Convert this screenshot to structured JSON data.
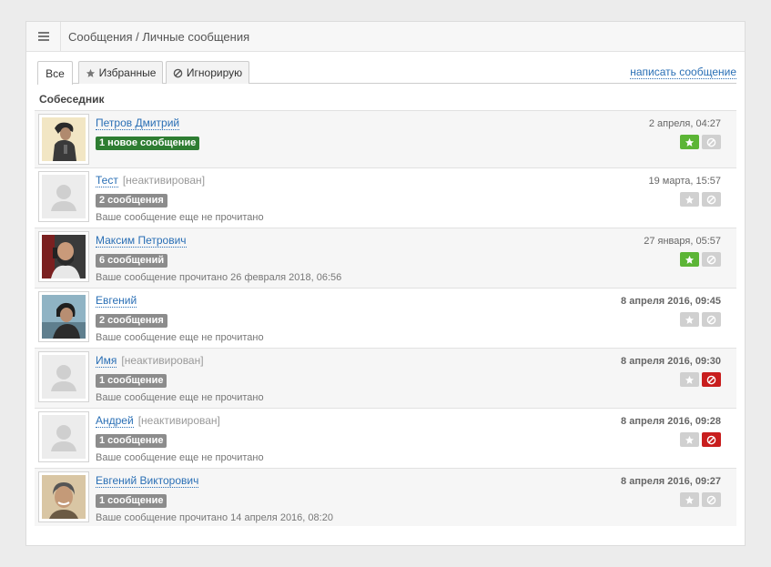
{
  "header": {
    "title": "Сообщения / Личные сообщения",
    "menu_icon": "list-icon"
  },
  "tabs": [
    {
      "label": "Все",
      "icon": "",
      "active": true
    },
    {
      "label": "Избранные",
      "icon": "star-icon",
      "active": false
    },
    {
      "label": "Игнорирую",
      "icon": "ban-icon",
      "active": false
    }
  ],
  "write_link": "написать сообщение",
  "column_header": "Собеседник",
  "colors": {
    "link": "#2a6fb5",
    "new_badge": "#2e7d32",
    "badge": "#8c8c8c",
    "favorite_on": "#5cb536",
    "ignore_on": "#c81e1e",
    "button_off": "#d0d0d0"
  },
  "conversations": [
    {
      "name": "Петров Дмитрий",
      "inactive": "",
      "count": "1 новое сообщение",
      "new": true,
      "status": "",
      "date": "2 апреля, 04:27",
      "date_bold": false,
      "favorite": true,
      "ignored": false,
      "avatar": "photo"
    },
    {
      "name": "Тест",
      "inactive": "[неактивирован]",
      "count": "2 сообщения",
      "new": false,
      "status": "Ваше сообщение еще не прочитано",
      "date": "19 марта, 15:57",
      "date_bold": false,
      "favorite": false,
      "ignored": false,
      "avatar": "placeholder"
    },
    {
      "name": "Максим Петрович",
      "inactive": "",
      "count": "6 сообщений",
      "new": false,
      "status": "Ваше сообщение прочитано 26 февраля 2018, 06:56",
      "date": "27 января, 05:57",
      "date_bold": false,
      "favorite": true,
      "ignored": false,
      "avatar": "photo"
    },
    {
      "name": "Евгений",
      "inactive": "",
      "count": "2 сообщения",
      "new": false,
      "status": "Ваше сообщение еще не прочитано",
      "date": "8 апреля 2016, 09:45",
      "date_bold": true,
      "favorite": false,
      "ignored": false,
      "avatar": "photo"
    },
    {
      "name": "Имя",
      "inactive": "[неактивирован]",
      "count": "1 сообщение",
      "new": false,
      "status": "Ваше сообщение еще не прочитано",
      "date": "8 апреля 2016, 09:30",
      "date_bold": true,
      "favorite": false,
      "ignored": true,
      "avatar": "placeholder"
    },
    {
      "name": "Андрей",
      "inactive": "[неактивирован]",
      "count": "1 сообщение",
      "new": false,
      "status": "Ваше сообщение еще не прочитано",
      "date": "8 апреля 2016, 09:28",
      "date_bold": true,
      "favorite": false,
      "ignored": true,
      "avatar": "placeholder"
    },
    {
      "name": "Евгений Викторович",
      "inactive": "",
      "count": "1 сообщение",
      "new": false,
      "status": "Ваше сообщение прочитано 14 апреля 2016, 08:20",
      "date": "8 апреля 2016, 09:27",
      "date_bold": true,
      "favorite": false,
      "ignored": false,
      "avatar": "photo"
    }
  ]
}
